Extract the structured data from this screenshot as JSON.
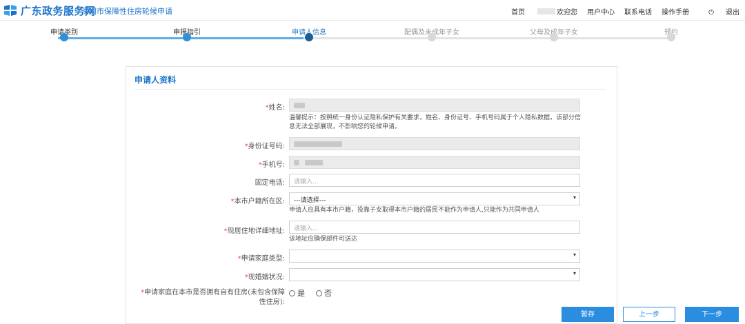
{
  "header": {
    "brand": "广东政务服务网",
    "subtitle": "深圳市保障性住房轮候申请",
    "nav": {
      "home": "首页",
      "welcome": "欢迎您",
      "user_center": "用户中心",
      "contact": "联系电话",
      "manual": "操作手册",
      "logout": "退出"
    }
  },
  "steps": [
    {
      "label": "申请类别",
      "state": "done"
    },
    {
      "label": "申报指引",
      "state": "done"
    },
    {
      "label": "申请人信息",
      "state": "active"
    },
    {
      "label": "配偶及未成年子女",
      "state": "todo"
    },
    {
      "label": "父母及成年子女",
      "state": "todo"
    },
    {
      "label": "预约",
      "state": "todo"
    }
  ],
  "form": {
    "title": "申请人资料",
    "name": {
      "label": "姓名:"
    },
    "name_hint": "温馨提示：按照统一身份认证隐私保护有关要求，姓名、身份证号、手机号码属于个人隐私数据，该部分信息无法全部展现，不影响您的轮候申请。",
    "id_number": {
      "label": "身份证号码:"
    },
    "mobile": {
      "label": "手机号:"
    },
    "landline": {
      "label": "固定电话:",
      "placeholder": "请输入..."
    },
    "hukou_district": {
      "label": "本市户籍所在区:",
      "value": "---请选择---"
    },
    "hukou_hint": "申请人应具有本市户籍，投靠子女取得本市户籍的居民不能作为申请人,只能作为共同申请人",
    "address": {
      "label": "现居住地详细地址:",
      "placeholder": "请输入..."
    },
    "address_hint": "该地址应确保邮件可送达",
    "family_type": {
      "label": "申请家庭类型:"
    },
    "marital_status": {
      "label": "现婚姻状况:"
    },
    "own_house": {
      "label": "申请家庭在本市是否拥有自有住房(未包含保障性住房):",
      "options": [
        "是",
        "否"
      ]
    }
  },
  "buttons": {
    "save": "暂存",
    "prev": "上一步",
    "next": "下一步"
  },
  "colors": {
    "brand": "#1a73c8",
    "primary": "#2a8de0",
    "required": "#e74c3c"
  }
}
